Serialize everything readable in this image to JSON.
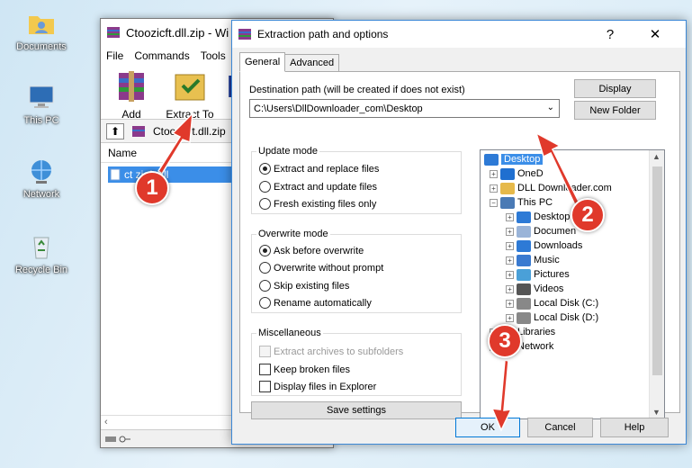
{
  "desktop": {
    "icons": [
      {
        "label": "Documents",
        "icon": "folder-user-icon"
      },
      {
        "label": "This PC",
        "icon": "computer-icon"
      },
      {
        "label": "Network",
        "icon": "network-icon"
      },
      {
        "label": "Recycle Bin",
        "icon": "recycle-bin-icon"
      }
    ]
  },
  "winrar": {
    "title": "Ctoozicft.dll.zip - Wi",
    "menu": [
      "File",
      "Commands",
      "Tools"
    ],
    "toolbar": [
      {
        "label": "Add",
        "icon": "winrar-add-icon"
      },
      {
        "label": "Extract To",
        "icon": "extract-to-icon"
      }
    ],
    "path": "Ctoozicft.dll.zip",
    "column_name": "Name",
    "file": "Ctoozicft.dll",
    "file_visible": "ct     zicft.dll"
  },
  "dialog": {
    "title": "Extraction path and options",
    "help": "?",
    "close": "✕",
    "tabs": [
      "General",
      "Advanced"
    ],
    "destination_label": "Destination path (will be created if does not exist)",
    "destination_value": "C:\\Users\\DllDownloader_com\\Desktop",
    "display_button": "Display",
    "new_folder_button": "New Folder",
    "update_mode": {
      "label": "Update mode",
      "options": [
        "Extract and replace files",
        "Extract and update files",
        "Fresh existing files only"
      ],
      "selected": 0
    },
    "overwrite_mode": {
      "label": "Overwrite mode",
      "options": [
        "Ask before overwrite",
        "Overwrite without prompt",
        "Skip existing files",
        "Rename automatically"
      ],
      "selected": 0
    },
    "misc": {
      "label": "Miscellaneous",
      "options": [
        {
          "label": "Extract archives to subfolders",
          "checked": false,
          "disabled": true
        },
        {
          "label": "Keep broken files",
          "checked": false,
          "disabled": false
        },
        {
          "label": "Display files in Explorer",
          "checked": false,
          "disabled": false
        }
      ]
    },
    "save_settings": "Save settings",
    "tree": [
      {
        "label": "Desktop",
        "icon": "desktop-icon",
        "selected": true,
        "expander": ""
      },
      {
        "label": "OneD",
        "icon": "onedrive-icon",
        "expander": "+"
      },
      {
        "label": "DLL Downloader.com",
        "icon": "user-folder-icon",
        "expander": "+"
      },
      {
        "label": "This PC",
        "icon": "computer-icon",
        "expander": "−"
      },
      {
        "label": "Desktop",
        "icon": "desktop-icon",
        "expander": "+"
      },
      {
        "label": "Documen",
        "icon": "document-icon",
        "expander": "+"
      },
      {
        "label": "Downloads",
        "icon": "download-icon",
        "expander": "+"
      },
      {
        "label": "Music",
        "icon": "music-icon",
        "expander": "+"
      },
      {
        "label": "Pictures",
        "icon": "pictures-icon",
        "expander": "+"
      },
      {
        "label": "Videos",
        "icon": "videos-icon",
        "expander": "+"
      },
      {
        "label": "Local Disk (C:)",
        "icon": "disk-icon",
        "expander": "+"
      },
      {
        "label": "Local Disk (D:)",
        "icon": "disk-icon",
        "expander": "+"
      },
      {
        "label": "Libraries",
        "icon": "libraries-icon",
        "expander": "+"
      },
      {
        "label": "Network",
        "icon": "network-icon",
        "expander": "+"
      }
    ],
    "ok": "OK",
    "cancel": "Cancel",
    "help_button": "Help"
  },
  "callouts": [
    "1",
    "2",
    "3"
  ],
  "colors": {
    "callout": "#e0392b",
    "selection": "#3b8ee8",
    "accent": "#3c88d6"
  }
}
